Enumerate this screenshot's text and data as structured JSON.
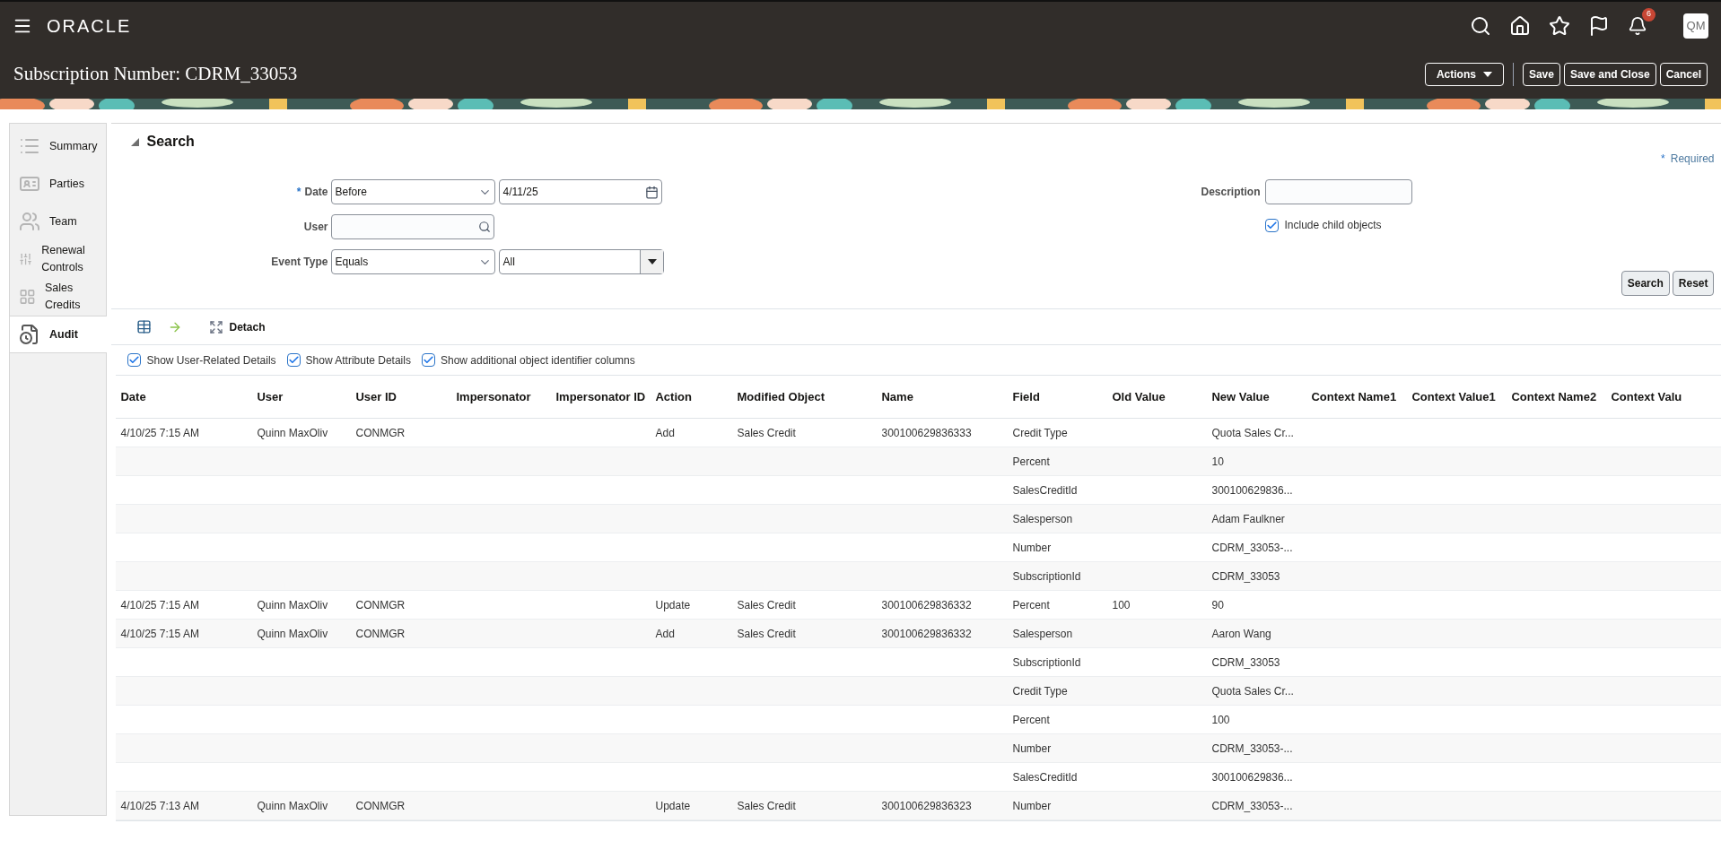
{
  "header": {
    "logo": "ORACLE",
    "notifications": "6",
    "avatar": "QM",
    "title": "Subscription Number: CDRM_33053",
    "buttons": [
      {
        "label": "Actions",
        "kind": "menu"
      },
      {
        "label": "Save",
        "kind": "plain"
      },
      {
        "label": "Save and Close",
        "kind": "plain"
      },
      {
        "label": "Cancel",
        "kind": "plain"
      }
    ]
  },
  "sidebar": {
    "items": [
      {
        "label": "Summary",
        "kind": "list",
        "selected": false
      },
      {
        "label": "Parties",
        "kind": "card",
        "selected": false
      },
      {
        "label": "Team",
        "kind": "people",
        "selected": false
      },
      {
        "label": "Renewal Controls",
        "kind": "sliders",
        "selected": false
      },
      {
        "label": "Sales Credits",
        "kind": "grid",
        "selected": false
      },
      {
        "label": "Audit",
        "kind": "audit",
        "selected": true
      }
    ]
  },
  "search": {
    "title": "Search",
    "required_mark": "*",
    "required_note": "Required",
    "date": {
      "required_mark": "*",
      "label": "Date",
      "operator": "Before",
      "value": "4/11/25"
    },
    "user": {
      "label": "User"
    },
    "event_type": {
      "label": "Event Type",
      "operator": "Equals",
      "value": "All"
    },
    "description": {
      "label": "Description"
    },
    "include_child": {
      "label": "Include child objects",
      "checked": true
    },
    "buttons": [
      "Search",
      "Reset"
    ]
  },
  "toolbar": {
    "detach": "Detach",
    "options": [
      {
        "label": "Show User-Related Details",
        "checked": true
      },
      {
        "label": "Show Attribute Details",
        "checked": true
      },
      {
        "label": "Show additional object identifier columns",
        "checked": true
      }
    ]
  },
  "table": {
    "columns": [
      "Date",
      "User",
      "User ID",
      "Impersonator",
      "Impersonator ID",
      "Action",
      "Modified Object",
      "Name",
      "Field",
      "Old Value",
      "New Value",
      "Context Name1",
      "Context Value1",
      "Context Name2",
      "Context Valu"
    ],
    "rows": [
      {
        "date": "4/10/25 7:15 AM",
        "user": "Quinn MaxOliv",
        "user_id": "CONMGR",
        "action": "Add",
        "modified_object": "Sales Credit",
        "name": "300100629836333",
        "field": "Credit Type",
        "new_value": "Quota Sales Cr..."
      },
      {
        "field": "Percent",
        "new_value": "10"
      },
      {
        "field": "SalesCreditId",
        "new_value": "300100629836..."
      },
      {
        "field": "Salesperson",
        "new_value": "Adam Faulkner"
      },
      {
        "field": "Number",
        "new_value": "CDRM_33053-..."
      },
      {
        "field": "SubscriptionId",
        "new_value": "CDRM_33053"
      },
      {
        "date": "4/10/25 7:15 AM",
        "user": "Quinn MaxOliv",
        "user_id": "CONMGR",
        "action": "Update",
        "modified_object": "Sales Credit",
        "name": "300100629836332",
        "field": "Percent",
        "old_value": "100",
        "new_value": "90"
      },
      {
        "date": "4/10/25 7:15 AM",
        "user": "Quinn MaxOliv",
        "user_id": "CONMGR",
        "action": "Add",
        "modified_object": "Sales Credit",
        "name": "300100629836332",
        "field": "Salesperson",
        "new_value": "Aaron Wang"
      },
      {
        "field": "SubscriptionId",
        "new_value": "CDRM_33053"
      },
      {
        "field": "Credit Type",
        "new_value": "Quota Sales Cr..."
      },
      {
        "field": "Percent",
        "new_value": "100"
      },
      {
        "field": "Number",
        "new_value": "CDRM_33053-..."
      },
      {
        "field": "SalesCreditId",
        "new_value": "300100629836..."
      },
      {
        "date": "4/10/25 7:13 AM",
        "user": "Quinn MaxOliv",
        "user_id": "CONMGR",
        "action": "Update",
        "modified_object": "Sales Credit",
        "name": "300100629836323",
        "field": "Number",
        "new_value": "CDRM_33053-..."
      }
    ]
  }
}
